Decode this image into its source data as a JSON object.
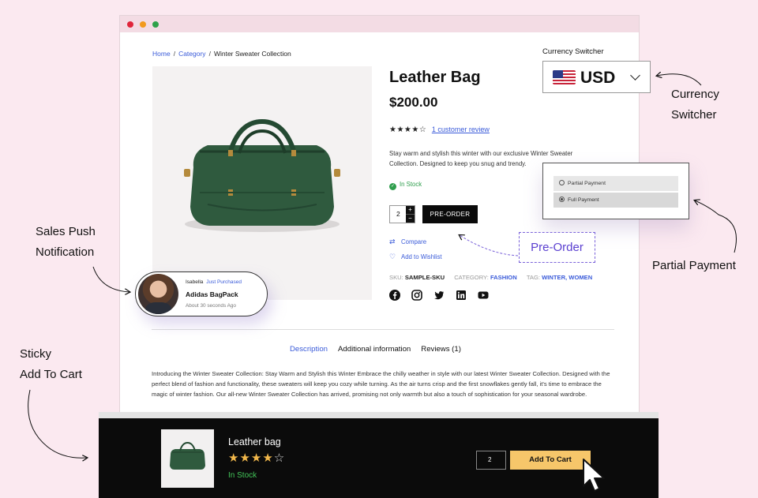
{
  "breadcrumb": {
    "home": "Home",
    "category": "Category",
    "current": "Winter Sweater Collection"
  },
  "product": {
    "title": "Leather Bag",
    "price": "$200.00",
    "rating": 4,
    "review_link": "1 customer review",
    "description": "Stay warm and stylish this winter with our exclusive Winter Sweater Collection. Designed to keep you snug and trendy.",
    "stock": "In Stock",
    "quantity": "2",
    "preorder_label": "PRE-ORDER",
    "compare_label": "Compare",
    "wishlist_label": "Add to Wishlist",
    "meta": {
      "sku_label": "SKU:",
      "sku": "SAMPLE-SKU",
      "category_label": "CATEGORY:",
      "category": "FASHION",
      "tag_label": "TAG:",
      "tags": "WINTER, WOMEN"
    },
    "social_icons": [
      "facebook-icon",
      "instagram-icon",
      "twitter-icon",
      "linkedin-icon",
      "youtube-icon"
    ]
  },
  "tabs": [
    {
      "label": "Description",
      "active": true
    },
    {
      "label": "Additional information",
      "active": false
    },
    {
      "label": "Reviews (1)",
      "active": false
    }
  ],
  "long_description": "Introducing the Winter Sweater Collection: Stay Warm and Stylish this Winter Embrace the chilly weather in style with our latest Winter Sweater Collection. Designed with the perfect blend of fashion and functionality, these sweaters will keep you cozy while turning. As the air turns crisp and the first snowflakes gently fall, it's time to embrace the magic of winter fashion. Our all-new Winter Sweater Collection has arrived, promising not only warmth but also a touch of sophistication for your seasonal wardrobe.",
  "currency": {
    "label": "Currency Switcher",
    "value": "USD"
  },
  "payment": {
    "options": [
      "Partial Payment",
      "Full Payment"
    ],
    "selected": "Full Payment"
  },
  "preorder_callout": "Pre-Order",
  "notification": {
    "name": "Isabella",
    "action": "Just Purchased",
    "product": "Adidas BagPack",
    "time": "About 30 seconds Ago"
  },
  "annotations": {
    "currency_1": "Currency",
    "currency_2": "Switcher",
    "sales_1": "Sales Push",
    "sales_2": "Notification",
    "partial": "Partial Payment",
    "sticky_1": "Sticky",
    "sticky_2": "Add To Cart"
  },
  "sticky_cart": {
    "title": "Leather bag",
    "stars": "★★★★",
    "empty_star": "☆",
    "stock": "In Stock",
    "quantity": "2",
    "button": "Add To Cart"
  },
  "colors": {
    "background": "#fbe9f0",
    "link": "#3a5bd9",
    "stock_green": "#2f9e4d",
    "accent_purple": "#5a3fd0",
    "add_to_cart": "#f6c66a"
  }
}
